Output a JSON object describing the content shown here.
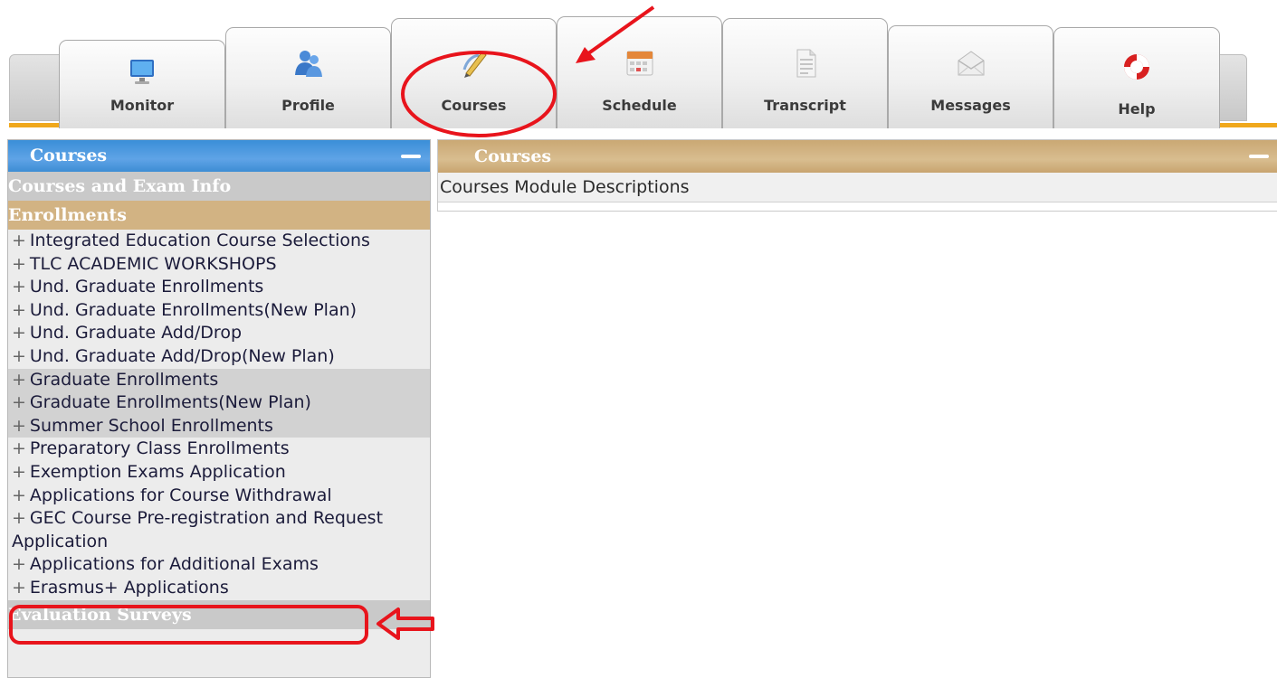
{
  "tabs": [
    {
      "label": "Monitor",
      "icon": "monitor-icon"
    },
    {
      "label": "Profile",
      "icon": "profile-users-icon"
    },
    {
      "label": "Courses",
      "icon": "pencil-paper-icon"
    },
    {
      "label": "Schedule",
      "icon": "calendar-icon"
    },
    {
      "label": "Transcript",
      "icon": "document-icon"
    },
    {
      "label": "Messages",
      "icon": "envelope-icon"
    },
    {
      "label": "Help",
      "icon": "lifebuoy-icon"
    }
  ],
  "left_panel": {
    "title": "Courses",
    "section_info": "Courses and Exam Info",
    "section_enroll": "Enrollments",
    "items": [
      "Integrated Education Course Selections",
      "TLC ACADEMIC WORKSHOPS",
      "Und. Graduate Enrollments",
      "Und. Graduate Enrollments(New Plan)",
      "Und. Graduate Add/Drop",
      "Und. Graduate Add/Drop(New Plan)",
      "Graduate Enrollments",
      "Graduate Enrollments(New Plan)",
      "Summer School Enrollments",
      "Preparatory Class Enrollments",
      "Exemption Exams Application",
      "Applications for Course Withdrawal",
      "GEC Course Pre-registration and Request Application",
      "Applications for Additional Exams",
      "Erasmus+ Applications"
    ],
    "section_eval": "Evaluation Surveys"
  },
  "right_panel": {
    "title": "Courses",
    "description": "Courses Module Descriptions"
  },
  "colors": {
    "accent_blue": "#3a8ed8",
    "accent_tan": "#d2b383",
    "orange_line": "#f0a81c",
    "annotation_red": "#e8141c"
  }
}
